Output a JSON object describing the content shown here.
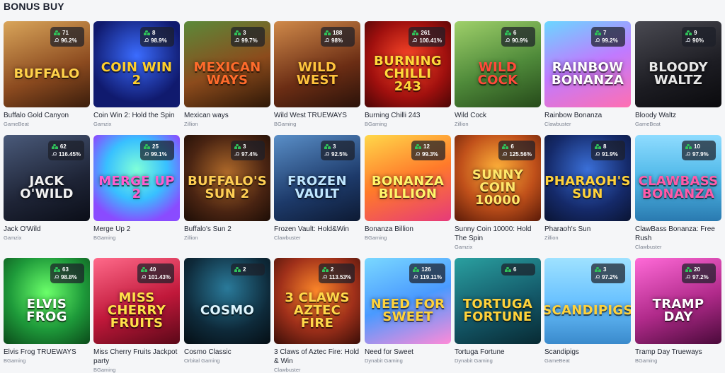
{
  "page": {
    "section_title": "BONUS BUY"
  },
  "games": [
    {
      "name": "Buffalo Gold Canyon",
      "provider": "GameBeat",
      "players": "71",
      "rtp": "96.2%",
      "logo": "BUFFALO",
      "bg": "linear-gradient(160deg,#d9a55a,#8b4a1f 60%,#3a1d0c)",
      "logo_color": "#ffd24a"
    },
    {
      "name": "Coin Win 2: Hold the Spin",
      "provider": "Gamzix",
      "players": "8",
      "rtp": "98.9%",
      "logo": "COIN WIN 2",
      "bg": "radial-gradient(circle at 50% 40%,#3b6cff,#101a6e 70%)",
      "logo_color": "#ffcf2b"
    },
    {
      "name": "Mexican ways",
      "provider": "Zillion",
      "players": "3",
      "rtp": "99.7%",
      "logo": "MEXICAN WAYS",
      "bg": "linear-gradient(160deg,#5b8a3a,#8c4b1c 55%,#2d1707)",
      "logo_color": "#ff6b2b"
    },
    {
      "name": "Wild West TRUEWAYS",
      "provider": "BGaming",
      "players": "188",
      "rtp": "98%",
      "logo": "WILD WEST",
      "bg": "linear-gradient(160deg,#d08a4a,#6b2d14 60%,#2a120a)",
      "logo_color": "#ffc43d"
    },
    {
      "name": "Burning Chilli 243",
      "provider": "BGaming",
      "players": "261",
      "rtp": "100.41%",
      "logo": "BURNING CHILLI 243",
      "bg": "radial-gradient(circle at 50% 45%,#ff4a2a,#a0100e 60%,#4a0606)",
      "logo_color": "#ffd83a"
    },
    {
      "name": "Wild Cock",
      "provider": "Zillion",
      "players": "6",
      "rtp": "90.9%",
      "logo": "WILD COCK",
      "bg": "linear-gradient(160deg,#9fd06a,#4f8a3a 55%,#264a1a)",
      "logo_color": "#ff4a3a"
    },
    {
      "name": "Rainbow Bonanza",
      "provider": "Clawbuster",
      "players": "7",
      "rtp": "99.2%",
      "logo": "RAINBOW BONANZA",
      "bg": "linear-gradient(160deg,#6ad7ff,#c07aff 50%,#ff6fb1)",
      "logo_color": "#ffffff"
    },
    {
      "name": "Bloody Waltz",
      "provider": "GameBeat",
      "players": "9",
      "rtp": "90%",
      "logo": "BLOODY WALTZ",
      "bg": "linear-gradient(160deg,#4a4a52,#1c1c22 60%,#0a0a0d)",
      "logo_color": "#e8e8e8"
    },
    {
      "name": "Jack O'Wild",
      "provider": "Gamzix",
      "players": "62",
      "rtp": "116.45%",
      "logo": "JACK O'WILD",
      "bg": "linear-gradient(160deg,#4a5a7a,#1e2436 60%,#0b0e18)",
      "logo_color": "#f2f2f2"
    },
    {
      "name": "Merge Up 2",
      "provider": "BGaming",
      "players": "25",
      "rtp": "99.1%",
      "logo": "MERGE UP 2",
      "bg": "radial-gradient(circle at 50% 40%,#7fffd8,#38c0ff 45%,#8a4bff 80%)",
      "logo_color": "#ff5ccf"
    },
    {
      "name": "Buffalo's Sun 2",
      "provider": "Zillion",
      "players": "3",
      "rtp": "97.4%",
      "logo": "BUFFALO'S SUN 2",
      "bg": "radial-gradient(circle at 50% 45%,#b06a2a,#4a2412 60%,#1c0d06)",
      "logo_color": "#ffcf54"
    },
    {
      "name": "Frozen Vault: Hold&Win",
      "provider": "Clawbuster",
      "players": "3",
      "rtp": "92.5%",
      "logo": "FROZEN VAULT",
      "bg": "linear-gradient(160deg,#5a8fc8,#1d3a6a 60%,#0d1a33)",
      "logo_color": "#bfe6ff"
    },
    {
      "name": "Bonanza Billion",
      "provider": "BGaming",
      "players": "12",
      "rtp": "99.3%",
      "logo": "BONANZA BILLION",
      "bg": "linear-gradient(160deg,#ffd84a,#ff7a2a 50%,#e63a7a)",
      "logo_color": "#fff56a"
    },
    {
      "name": "Sunny Coin 10000: Hold The Spin",
      "provider": "Gamzix",
      "players": "6",
      "rtp": "125.56%",
      "logo": "SUNNY COIN 10000",
      "bg": "radial-gradient(circle at 50% 40%,#ffb23a,#c0501a 55%,#5a1a08)",
      "logo_color": "#ffe76a"
    },
    {
      "name": "Pharaoh's Sun",
      "provider": "Zillion",
      "players": "8",
      "rtp": "91.9%",
      "logo": "PHARAOH'S SUN",
      "bg": "radial-gradient(circle at 50% 40%,#3a6fd8,#152a6a 60%,#0a1433)",
      "logo_color": "#ffd23a"
    },
    {
      "name": "ClawBass Bonanza: Free Rush",
      "provider": "Clawbuster",
      "players": "10",
      "rtp": "97.9%",
      "logo": "CLAWBASS BONANZA",
      "bg": "linear-gradient(180deg,#8fdcff,#4fb8e8 50%,#2a7ab0)",
      "logo_color": "#ff5aa8"
    },
    {
      "name": "Elvis Frog TRUEWAYS",
      "provider": "BGaming",
      "players": "63",
      "rtp": "98.8%",
      "logo": "ELVIS FROG",
      "bg": "radial-gradient(circle at 50% 40%,#6bff6a,#1e9a3a 55%,#0b4a1a)",
      "logo_color": "#ffffff"
    },
    {
      "name": "Miss Cherry Fruits Jackpot party",
      "provider": "BGaming",
      "players": "40",
      "rtp": "101.43%",
      "logo": "MISS CHERRY FRUITS",
      "bg": "linear-gradient(160deg,#ff6a8a,#c0183a 55%,#5a0818)",
      "logo_color": "#ffe04a"
    },
    {
      "name": "Cosmo Classic",
      "provider": "Orbital Gaming",
      "players": "2",
      "rtp": "",
      "logo": "COSMO",
      "bg": "radial-gradient(circle at 50% 35%,#2a7a9a,#0e2a3a 60%,#050e14)",
      "logo_color": "#dff6ff"
    },
    {
      "name": "3 Claws of Aztec Fire: Hold & Win",
      "provider": "Clawbuster",
      "players": "2",
      "rtp": "113.53%",
      "logo": "3 CLAWS AZTEC FIRE",
      "bg": "radial-gradient(circle at 50% 40%,#ff8a2a,#a0301a 55%,#3a0e08)",
      "logo_color": "#ffd84a"
    },
    {
      "name": "Need for Sweet",
      "provider": "Dynabit Gaming",
      "players": "126",
      "rtp": "119.11%",
      "logo": "NEED FOR SWEET",
      "bg": "linear-gradient(160deg,#7ad8ff,#4a9aff 50%,#ff8ad8)",
      "logo_color": "#ffd23a"
    },
    {
      "name": "Tortuga Fortune",
      "provider": "Dynabit Gaming",
      "players": "6",
      "rtp": "",
      "logo": "TORTUGA FORTUNE",
      "bg": "linear-gradient(160deg,#2aa0a0,#145a6a 55%,#082a33)",
      "logo_color": "#ffd23a"
    },
    {
      "name": "Scandipigs",
      "provider": "GameBeat",
      "players": "3",
      "rtp": "97.2%",
      "logo": "SCANDIPIGS",
      "bg": "linear-gradient(180deg,#9fe2ff,#6ac2ff 50%,#3a8acc)",
      "logo_color": "#ffd23a"
    },
    {
      "name": "Tramp Day Trueways",
      "provider": "BGaming",
      "players": "20",
      "rtp": "97.2%",
      "logo": "TRAMP DAY",
      "bg": "linear-gradient(160deg,#ff6ad8,#b02a8a 55%,#4a0a3a)",
      "logo_color": "#ffffff"
    }
  ]
}
